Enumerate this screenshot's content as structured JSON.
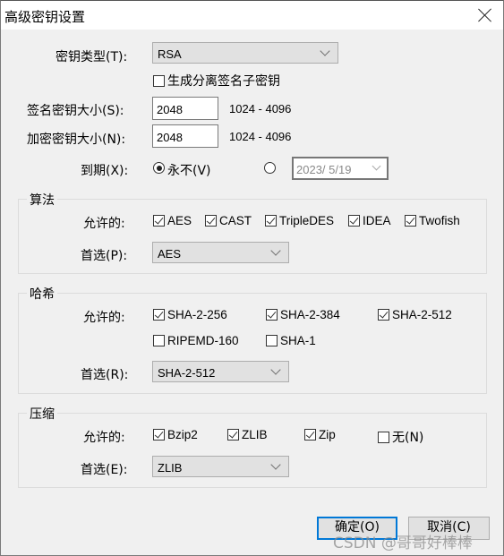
{
  "window": {
    "title": "高级密钥设置"
  },
  "key_type": {
    "label": "密钥类型(T):",
    "value": "RSA",
    "separate_signing_key_label": "生成分离签名子密钥",
    "separate_signing_key_checked": false
  },
  "sign_key_size": {
    "label": "签名密钥大小(S):",
    "value": "2048",
    "range": "1024 - 4096"
  },
  "enc_key_size": {
    "label": "加密密钥大小(N):",
    "value": "2048",
    "range": "1024 - 4096"
  },
  "expiry": {
    "label": "到期(X):",
    "never_label": "永不(V)",
    "never_selected": true,
    "date_selected": false,
    "date_value": "2023/  5/19"
  },
  "algorithm": {
    "title": "算法",
    "allowed_label": "允许的:",
    "options": [
      {
        "label": "AES",
        "checked": true
      },
      {
        "label": "CAST",
        "checked": true
      },
      {
        "label": "TripleDES",
        "checked": true
      },
      {
        "label": "IDEA",
        "checked": true
      },
      {
        "label": "Twofish",
        "checked": true
      }
    ],
    "preferred_label": "首选(P):",
    "preferred_value": "AES"
  },
  "hash": {
    "title": "哈希",
    "allowed_label": "允许的:",
    "options": [
      {
        "label": "SHA-2-256",
        "checked": true
      },
      {
        "label": "SHA-2-384",
        "checked": true
      },
      {
        "label": "SHA-2-512",
        "checked": true
      },
      {
        "label": "RIPEMD-160",
        "checked": false
      },
      {
        "label": "SHA-1",
        "checked": false
      }
    ],
    "preferred_label": "首选(R):",
    "preferred_value": "SHA-2-512"
  },
  "compression": {
    "title": "压缩",
    "allowed_label": "允许的:",
    "options": [
      {
        "label": "Bzip2",
        "checked": true
      },
      {
        "label": "ZLIB",
        "checked": true
      },
      {
        "label": "Zip",
        "checked": true
      },
      {
        "label": "无(N)",
        "checked": false
      }
    ],
    "preferred_label": "首选(E):",
    "preferred_value": "ZLIB"
  },
  "buttons": {
    "ok": "确定(O)",
    "cancel": "取消(C)"
  },
  "watermark": "CSDN @哥哥好棒棒",
  "colors": {
    "default_button_border": "#0078d7",
    "background": "#f0f0f0"
  }
}
